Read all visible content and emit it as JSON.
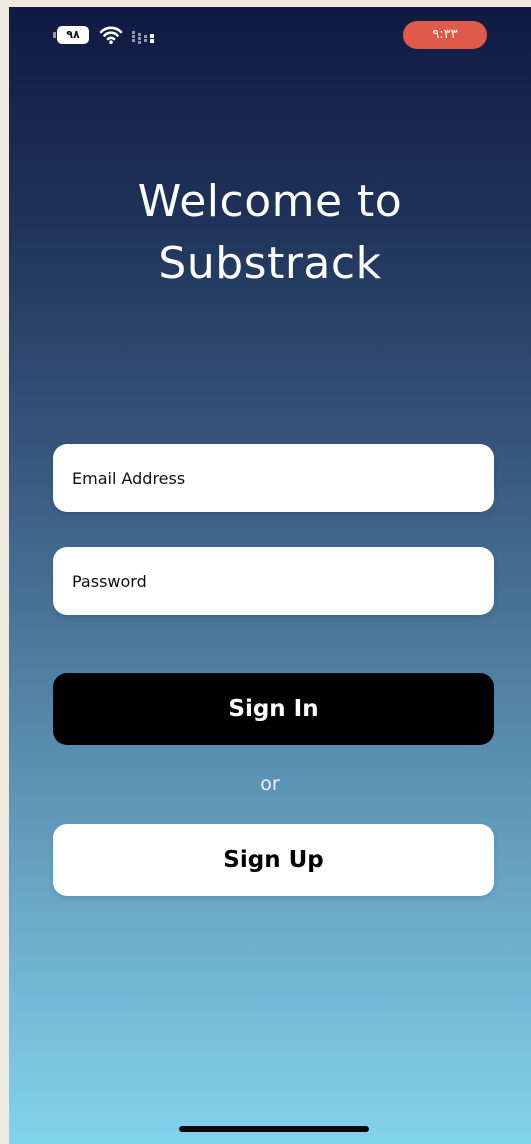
{
  "status_bar": {
    "battery_level": "۹۸",
    "time": "۹:۳۳",
    "icons": [
      "battery-icon",
      "wifi-icon",
      "signal-icon"
    ],
    "time_pill_color": "#df5a4b"
  },
  "welcome": {
    "line1": "Welcome to",
    "line2": "Substrack"
  },
  "form": {
    "email_placeholder": "Email Address",
    "password_placeholder": "Password",
    "sign_in_label": "Sign In",
    "or_label": "or",
    "sign_up_label": "Sign Up"
  },
  "colors": {
    "background_top": "#101a42",
    "background_bottom": "#82d3ee",
    "sign_in_bg": "#000000",
    "sign_up_bg": "#ffffff"
  }
}
